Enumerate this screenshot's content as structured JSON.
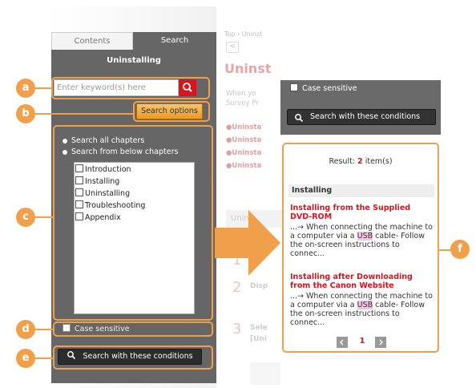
{
  "tabs": {
    "contents": "Contents",
    "search": "Search"
  },
  "panel_title": "Uninstalling",
  "keyword_placeholder": "Enter keyword(s) here",
  "search_options_label": "Search options",
  "scope": {
    "all": "Search all chapters",
    "from_below": "Search from below chapters"
  },
  "chapters": [
    "Introduction",
    "Installing",
    "Uninstalling",
    "Troubleshooting",
    "Appendix"
  ],
  "case_sensitive_label": "Case sensitive",
  "search_button_label": "Search with these conditions",
  "markers": {
    "a": "a",
    "b": "b",
    "c": "c",
    "d": "d",
    "e": "e",
    "f": "f"
  },
  "background_page": {
    "breadcrumb": "Top › Uninst",
    "heading": "Uninst",
    "intro": [
      "When yo",
      "Survey Pr"
    ],
    "links": [
      "Uninsta",
      "Uninsta",
      "Uninsta",
      "Uninsta"
    ],
    "section": "Unin",
    "steps": [
      "1",
      "2",
      "3"
    ],
    "step_texts": [
      "Disp",
      "Sele",
      "[Uni"
    ]
  },
  "results": {
    "label": "Result:",
    "count": "2",
    "unit": "item(s)",
    "category": "Installing",
    "items": [
      {
        "title_lines": [
          "Installing from the Supplied",
          "DVD-ROM"
        ],
        "snippet_line1": "...→ When connecting the machine to",
        "snippet_pre": "a computer via a ",
        "highlight": "USB",
        "snippet_post": " cable- Follow",
        "snippet_line3": "the on-screen instructions to",
        "snippet_line4": "connec..."
      },
      {
        "title_lines": [
          "Installing after Downloading",
          "from the Canon Website"
        ],
        "snippet_line1": "...→ When connecting the machine to",
        "snippet_pre": "a computer via a ",
        "highlight": "USB",
        "snippet_post": " cable- Follow",
        "snippet_line3": "the on-screen instructions to",
        "snippet_line4": "connec..."
      }
    ],
    "page": "1"
  }
}
